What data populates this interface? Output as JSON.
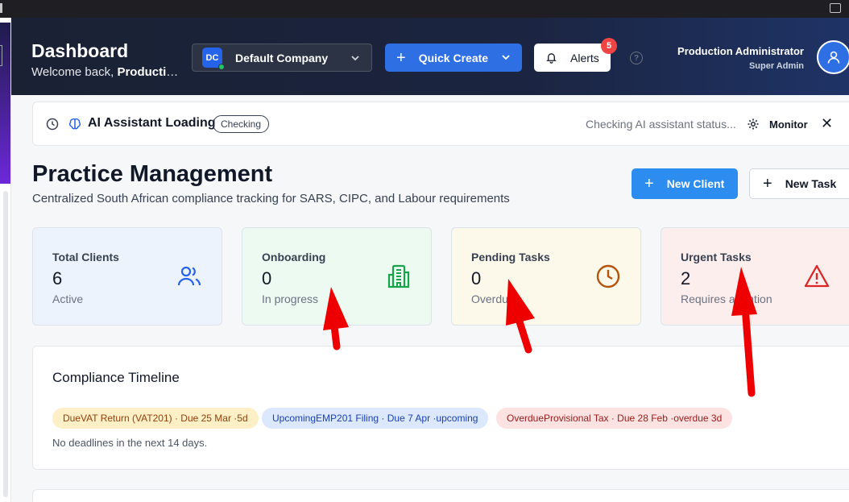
{
  "header": {
    "title": "Dashboard",
    "welcome_prefix": "Welcome back, ",
    "welcome_name": "Productio",
    "company": {
      "initials": "DC",
      "name": "Default Company"
    },
    "quick_create_label": "Quick Create",
    "alerts_label": "Alerts",
    "alerts_count": "5",
    "help_glyph": "?",
    "user": {
      "name": "Production Administrator",
      "role": "Super Admin"
    }
  },
  "ai_banner": {
    "title": "AI Assistant Loading",
    "chip": "Checking",
    "status": "Checking AI assistant status...",
    "monitor_label": "Monitor",
    "close_glyph": "✕"
  },
  "practice": {
    "title": "Practice Management",
    "subtitle": "Centralized South African compliance tracking for SARS, CIPC, and Labour requirements",
    "new_client_label": "New Client",
    "new_task_label": "New Task"
  },
  "stats": [
    {
      "label": "Total Clients",
      "value": "6",
      "caption": "Active",
      "icon": "users-icon",
      "color": "#2563eb"
    },
    {
      "label": "Onboarding",
      "value": "0",
      "caption": "In progress",
      "icon": "building-icon",
      "color": "#16a34a"
    },
    {
      "label": "Pending Tasks",
      "value": "0",
      "caption": "Overdue",
      "icon": "clock-icon",
      "color": "#b45309"
    },
    {
      "label": "Urgent Tasks",
      "value": "2",
      "caption": "Requires attention",
      "icon": "alert-triangle-icon",
      "color": "#dc2626"
    }
  ],
  "timeline": {
    "title": "Compliance Timeline",
    "chips": [
      {
        "text": "DueVAT Return (VAT201) · Due 25 Mar ·5d",
        "status": "due"
      },
      {
        "text": "UpcomingEMP201 Filing · Due 7 Apr ·upcoming",
        "status": "upcoming"
      },
      {
        "text": "OverdueProvisional Tax · Due 28 Feb ·overdue 3d",
        "status": "overdue"
      }
    ],
    "empty_text": "No deadlines in the next 14 days."
  },
  "colors": {
    "header_bg": "#1b2440",
    "primary": "#2f6fe4",
    "annotation_red": "#ef0000"
  }
}
